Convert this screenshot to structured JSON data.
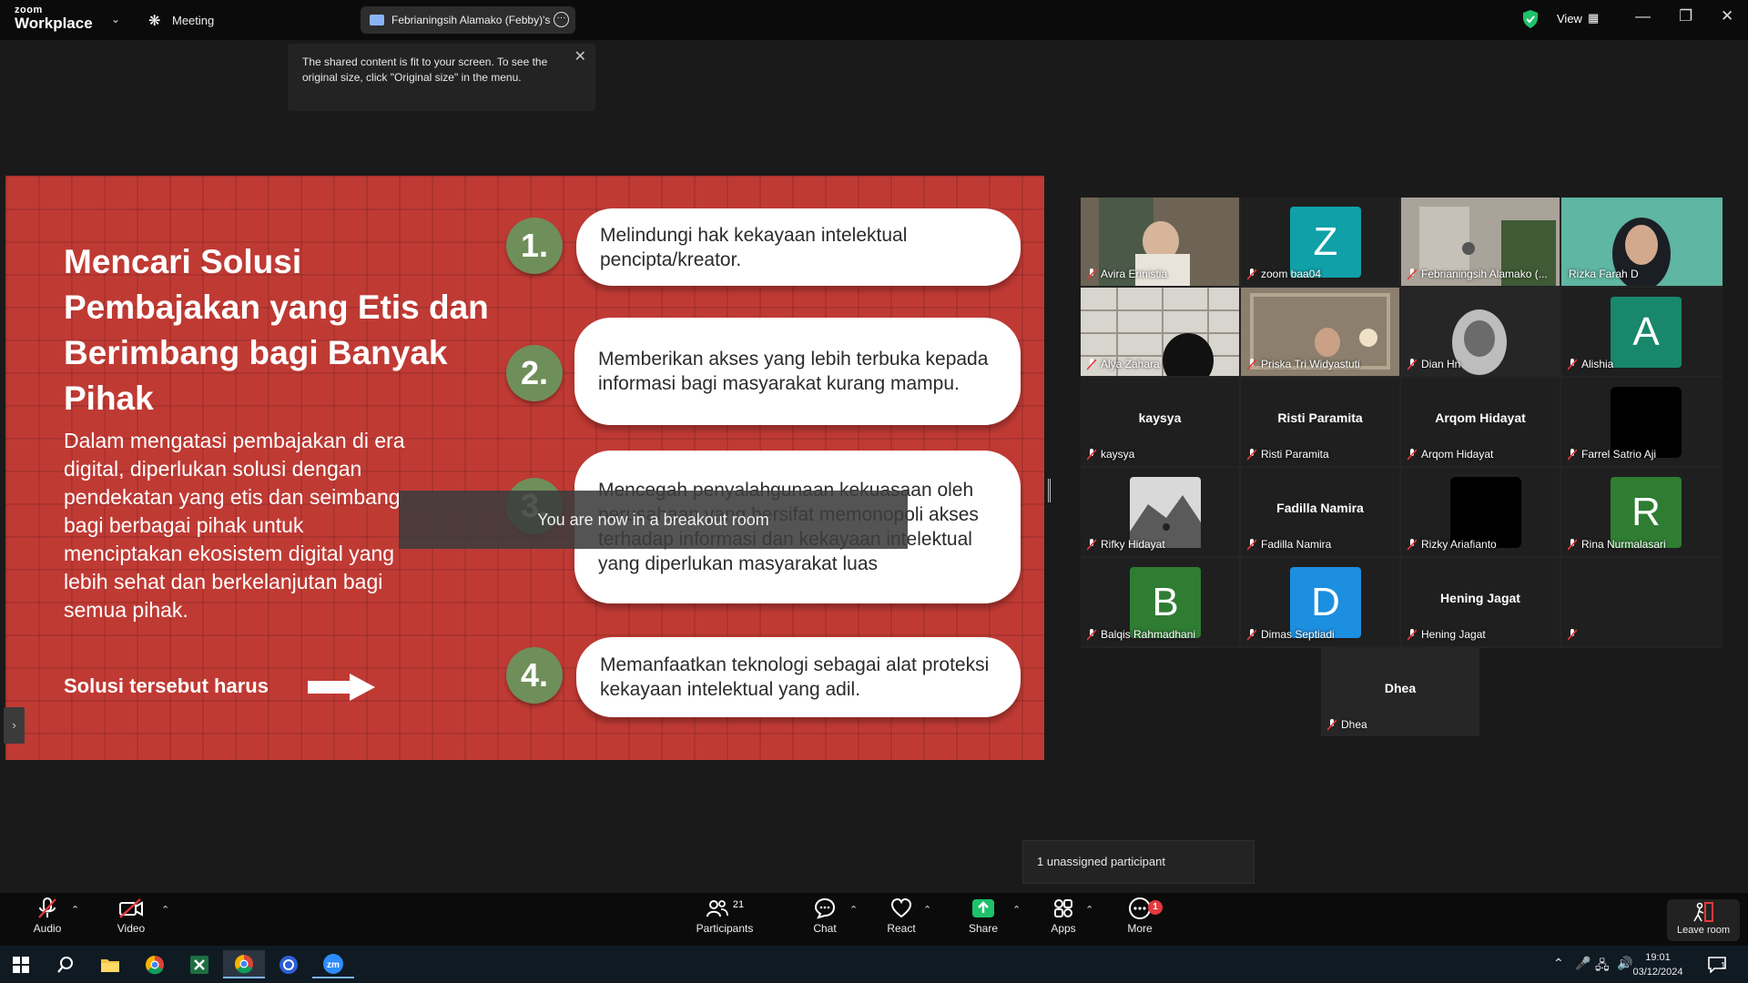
{
  "titlebar": {
    "brand_top": "zoom",
    "brand_bottom": "Workplace",
    "meeting_label": "Meeting",
    "share_tab": "Febrianingsih Alamako (Febby)'s",
    "view_label": "View"
  },
  "tooltip": {
    "text": "The shared content is fit to your screen. To see the original size, click \"Original size\" in the menu."
  },
  "slide": {
    "title": "Mencari Solusi Pembajakan yang Etis dan Berimbang bagi Banyak Pihak",
    "body": "Dalam mengatasi pembajakan di era digital, diperlukan solusi dengan pendekatan yang etis dan seimbang bagi berbagai pihak untuk menciptakan ekosistem digital yang lebih sehat dan berkelanjutan bagi semua pihak.",
    "footer": "Solusi tersebut harus",
    "items": [
      {
        "num": "1.",
        "text": "Melindungi hak kekayaan intelektual pencipta/kreator."
      },
      {
        "num": "2.",
        "text": "Memberikan akses yang lebih terbuka kepada informasi bagi masyarakat kurang mampu."
      },
      {
        "num": "3.",
        "text": "Mencegah penyalahgunaan kekuasaan oleh perusahaan yang bersifat memonopoli akses terhadap informasi dan kekayaan intelektual yang diperlukan masyarakat luas"
      },
      {
        "num": "4.",
        "text": "Memanfaatkan teknologi sebagai alat proteksi kekayaan intelektual yang adil."
      }
    ]
  },
  "breakout_notice": "You are now in a breakout room",
  "participants": [
    {
      "name": "Avira Erinistia"
    },
    {
      "name": "zoom baa04",
      "initial": "Z"
    },
    {
      "name": "Febrianingsih Alamako (..."
    },
    {
      "name": "Rizka Farah D"
    },
    {
      "name": "Alya Zahara"
    },
    {
      "name": "Priska Tri Widyastuti"
    },
    {
      "name": "Dian Hn"
    },
    {
      "name": "Alishia",
      "initial": "A"
    },
    {
      "name": "kaysya",
      "display": "kaysya"
    },
    {
      "name": "Risti Paramita",
      "display": "Risti Paramita"
    },
    {
      "name": "Arqom Hidayat",
      "display": "Arqom Hidayat"
    },
    {
      "name": "Farrel Satrio Aji"
    },
    {
      "name": "Rifky Hidayat"
    },
    {
      "name": "Fadilla Namira",
      "display": "Fadilla Namira"
    },
    {
      "name": "Rizky Ariafianto"
    },
    {
      "name": "Rina Nurmalasari",
      "initial": "R"
    },
    {
      "name": "Balqis Rahmadhani",
      "initial": "B"
    },
    {
      "name": "Dimas Septiadi",
      "initial": "D"
    },
    {
      "name": "Hening Jagat",
      "display": "Hening Jagat"
    },
    {
      "name": "Dhea",
      "display": "Dhea"
    }
  ],
  "unassigned": "1 unassigned participant",
  "toolbar": {
    "audio": "Audio",
    "video": "Video",
    "participants": "Participants",
    "participants_count": "21",
    "chat": "Chat",
    "react": "React",
    "share": "Share",
    "apps": "Apps",
    "more": "More",
    "more_badge": "1",
    "leave": "Leave room"
  },
  "taskbar": {
    "time": "19:01",
    "date": "03/12/2024",
    "notif": "1"
  },
  "colors": {
    "slide_red": "#c03a34",
    "number_green": "#6f8f5a",
    "active_speaker": "#3ccb7f",
    "avatar_teal": "#0fa0a8",
    "avatar_green": "#18876b",
    "avatar_darkgreen": "#2e7d32",
    "avatar_blue": "#1c8fe0",
    "share_green": "#1fc16b",
    "badge_red": "#e5393e"
  }
}
